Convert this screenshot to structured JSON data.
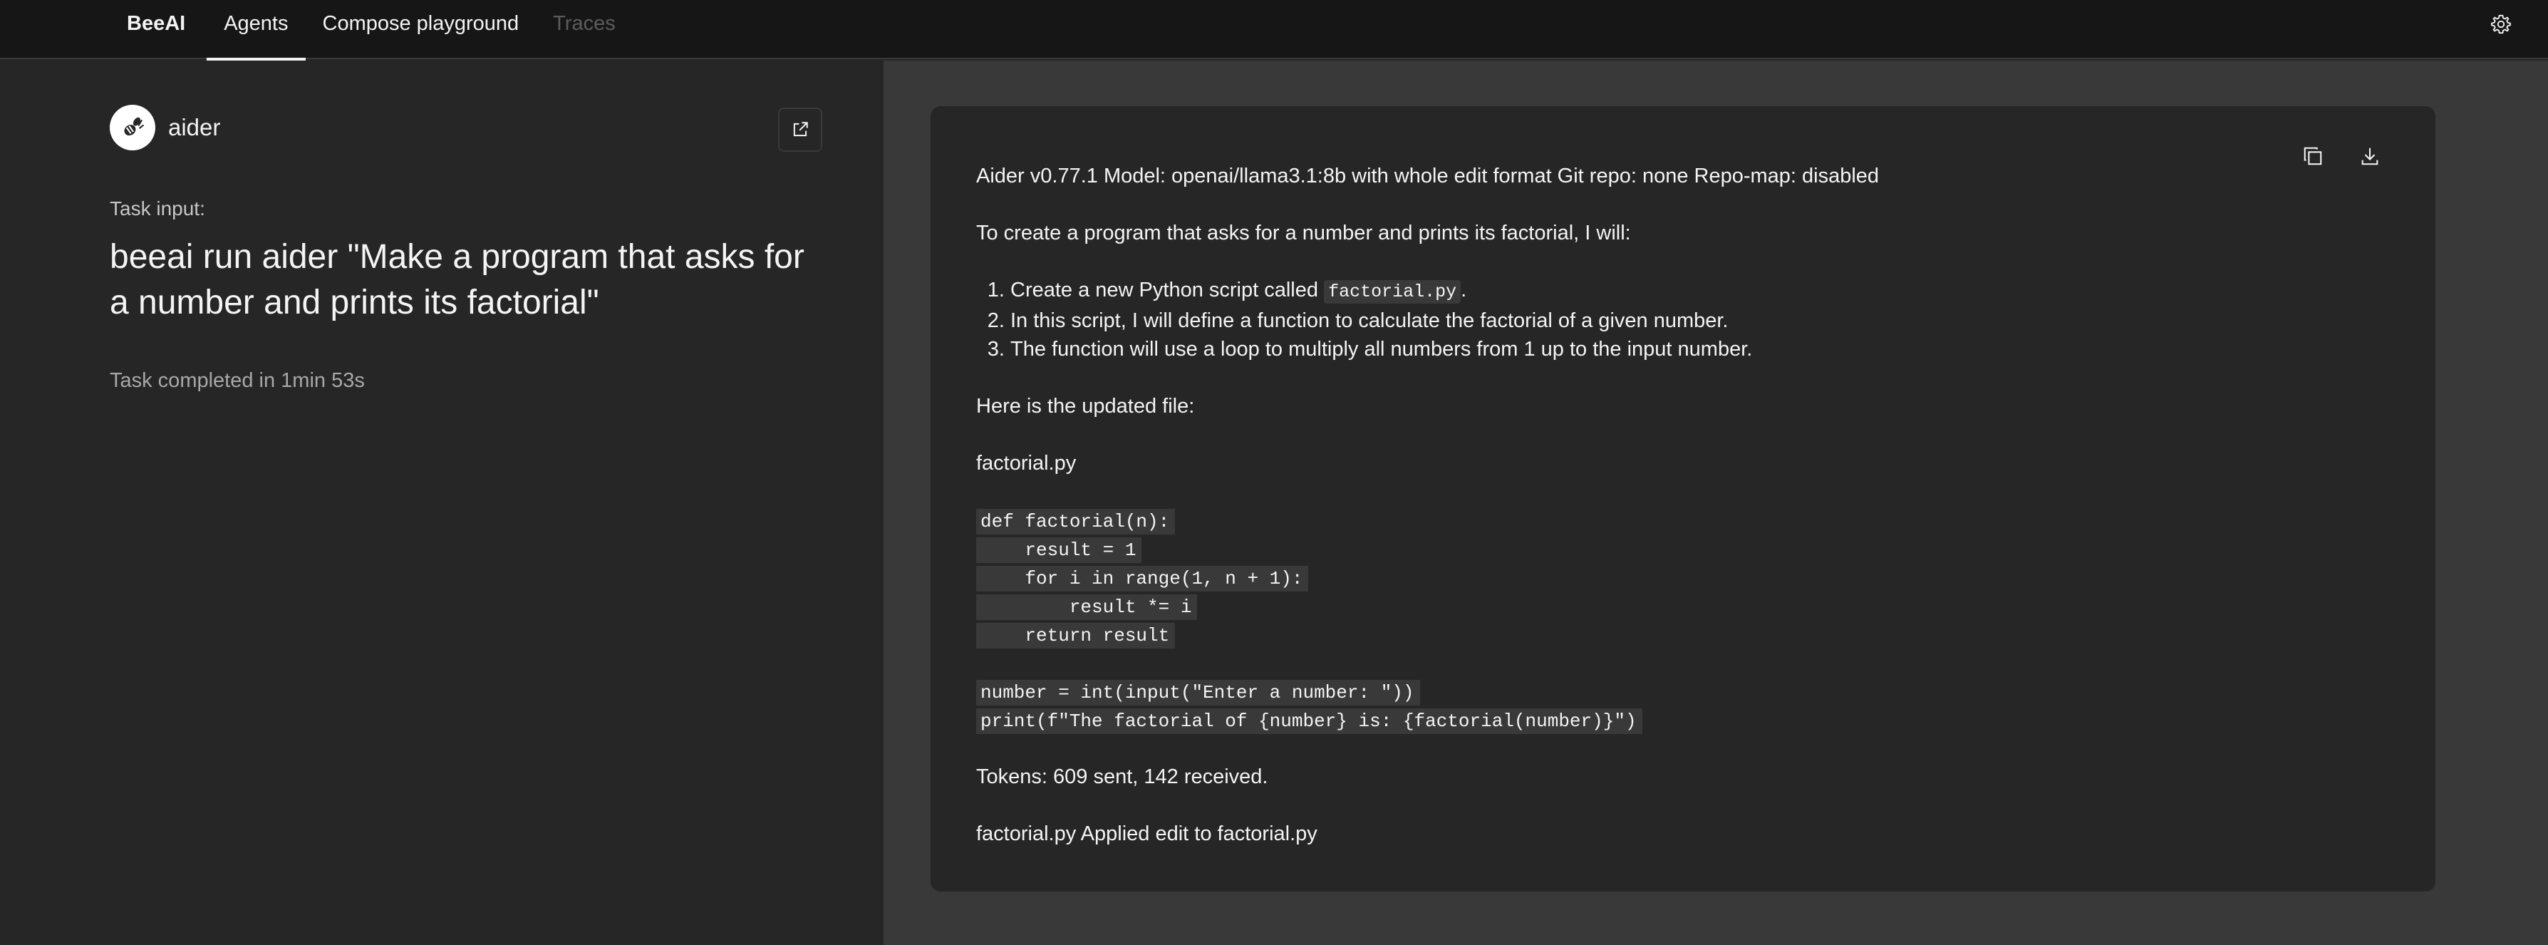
{
  "nav": {
    "brand": "BeeAI",
    "tabs": [
      {
        "label": "Agents",
        "active": true
      },
      {
        "label": "Compose playground",
        "active": false
      },
      {
        "label": "Traces",
        "active": false,
        "disabled": true
      }
    ],
    "settings_icon": "gear-icon"
  },
  "agent": {
    "name": "aider",
    "avatar_icon": "bee-icon",
    "open_icon": "launch-icon",
    "task_label": "Task input:",
    "task_input": "beeai run aider \"Make a program that asks for a number and prints its factorial\"",
    "status": "Task completed in 1min 53s"
  },
  "output": {
    "copy_icon": "copy-icon",
    "download_icon": "download-icon",
    "header_line": "Aider v0.77.1 Model: openai/llama3.1:8b with whole edit format Git repo: none Repo-map: disabled",
    "intro": "To create a program that asks for a number and prints its factorial, I will:",
    "steps": {
      "step1_prefix": "Create a new Python script called ",
      "step1_code": "factorial.py",
      "step1_suffix": ".",
      "step2": "In this script, I will define a function to calculate the factorial of a given number.",
      "step3": "The function will use a loop to multiply all numbers from 1 up to the input number."
    },
    "updated_file_label": "Here is the updated file:",
    "filename": "factorial.py",
    "code": [
      "def factorial(n):",
      "    result = 1",
      "    for i in range(1, n + 1):",
      "        result *= i",
      "    return result",
      "",
      "number = int(input(\"Enter a number: \"))",
      "print(f\"The factorial of {number} is: {factorial(number)}\")"
    ],
    "tokens": "Tokens: 609 sent, 142 received.",
    "applied": "factorial.py Applied edit to factorial.py"
  }
}
